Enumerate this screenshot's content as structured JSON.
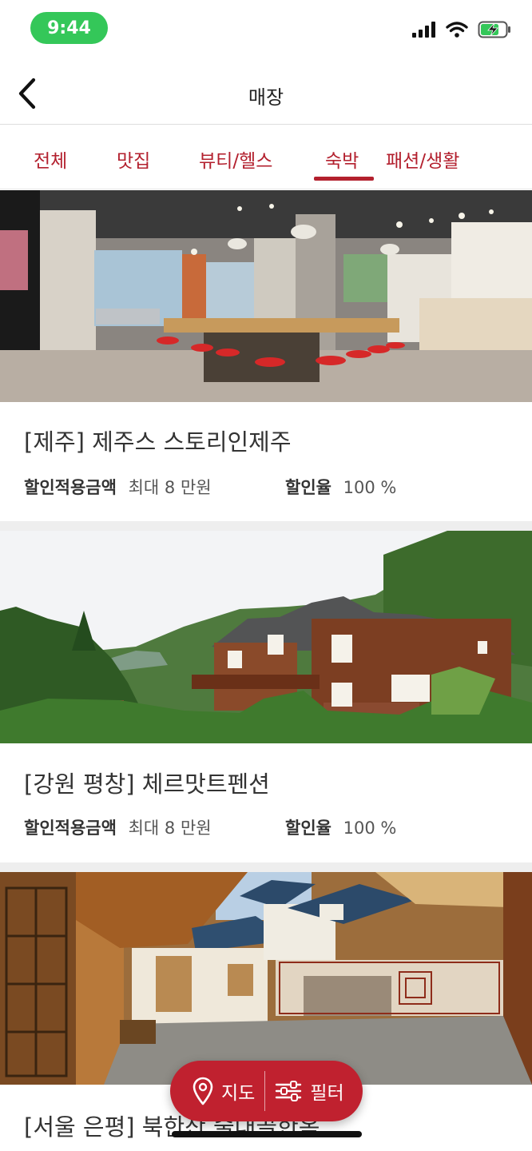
{
  "status_bar": {
    "time": "9:44"
  },
  "nav": {
    "title": "매장"
  },
  "tabs": [
    {
      "label": "전체"
    },
    {
      "label": "맛집"
    },
    {
      "label": "뷰티/헬스"
    },
    {
      "label": "숙박",
      "selected": true
    },
    {
      "label": "패션/생활"
    }
  ],
  "listings": [
    {
      "title": "[제주] 제주스 스토리인제주",
      "discount_amount_label": "할인적용금액",
      "discount_amount_value": "최대 8 만원",
      "discount_rate_label": "할인율",
      "discount_rate_value": "100 %"
    },
    {
      "title": "[강원 평창] 체르맛트펜션",
      "discount_amount_label": "할인적용금액",
      "discount_amount_value": "최대 8 만원",
      "discount_rate_label": "할인율",
      "discount_rate_value": "100 %"
    },
    {
      "title": "[서울 은평] 북한산 술대골한옥"
    }
  ],
  "fab": {
    "map_label": "지도",
    "filter_label": "필터"
  },
  "colors": {
    "accent": "#c0212f",
    "tab_text": "#b3202e",
    "status_time_bg": "#34c759"
  },
  "icons": [
    "back-arrow-icon",
    "signal-icon",
    "wifi-icon",
    "battery-charging-icon",
    "map-pin-icon",
    "filter-sliders-icon"
  ]
}
